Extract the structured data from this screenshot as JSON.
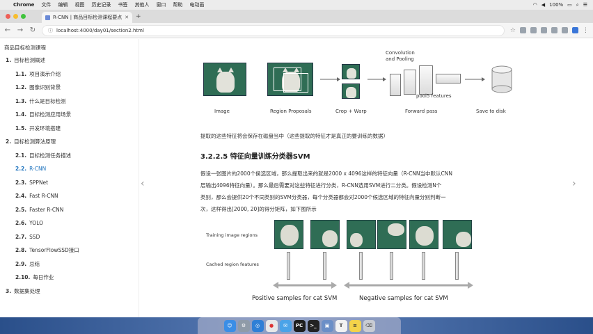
{
  "menubar": {
    "app": "Chrome",
    "items": [
      "文件",
      "编辑",
      "视图",
      "历史记录",
      "书签",
      "其他人",
      "窗口",
      "帮助",
      "电动画"
    ],
    "status": "100%",
    "time": ""
  },
  "tab": {
    "title": "R-CNN | 商品目标检测课程要点"
  },
  "url": "localhost:4000/day01/section2.html",
  "sidebar": {
    "title": "商品目标检测课程",
    "items": [
      {
        "num": "1.",
        "label": "目标检测概述",
        "level": 1
      },
      {
        "num": "1.1.",
        "label": "项目演示介绍",
        "level": 2
      },
      {
        "num": "1.2.",
        "label": "图像识别背景",
        "level": 2
      },
      {
        "num": "1.3.",
        "label": "什么是目标检测",
        "level": 2
      },
      {
        "num": "1.4.",
        "label": "目标检测应用场景",
        "level": 2
      },
      {
        "num": "1.5.",
        "label": "开发环境搭建",
        "level": 2
      },
      {
        "num": "2.",
        "label": "目标检测算法原理",
        "level": 1
      },
      {
        "num": "2.1.",
        "label": "目标检测任务描述",
        "level": 2
      },
      {
        "num": "2.2.",
        "label": "R-CNN",
        "level": 2,
        "active": true
      },
      {
        "num": "2.3.",
        "label": "SPPNet",
        "level": 2
      },
      {
        "num": "2.4.",
        "label": "Fast R-CNN",
        "level": 2
      },
      {
        "num": "2.5.",
        "label": "Faster R-CNN",
        "level": 2
      },
      {
        "num": "2.6.",
        "label": "YOLO",
        "level": 2
      },
      {
        "num": "2.7.",
        "label": "SSD",
        "level": 2
      },
      {
        "num": "2.8.",
        "label": "TensorFlowSSD接口",
        "level": 2
      },
      {
        "num": "2.9.",
        "label": "总结",
        "level": 2
      },
      {
        "num": "2.10.",
        "label": "每日作业",
        "level": 2
      },
      {
        "num": "3.",
        "label": "数据集处理",
        "level": 1
      }
    ]
  },
  "pipeline": {
    "labels": [
      "Image",
      "Region Proposals",
      "Crop + Warp",
      "Convolution",
      "and Pooling",
      "pool5 features",
      "Forward pass",
      "Save to disk"
    ]
  },
  "content": {
    "caption_line": "提取的这些特征将会保存在磁盘当中（这些提取的特征才是真正的要训练的数据）",
    "heading": "3.2.2.5 特征向量训练分类器SVM",
    "para_lines": [
      "假设一张图片的2000个侯选区域，那么提取出来的就是2000 x 4096这样的特征向量（R-CNN当中默认CNN",
      "层输出4096特征向量）。那么最后需要对这些特征进行分类，R-CNN选用SVM进行二分类。假设检测N个",
      "类别，那么会提供20个不同类别的SVM分类器，每个分类器都会对2000个候选区域的特征向量分别判断一",
      "次，这样得出[2000, 20]的得分矩阵，如下图所示"
    ]
  },
  "svm": {
    "row1_label": "Training image regions",
    "row2_label": "Cached region features",
    "positive": "Positive samples for cat SVM",
    "negative": "Negative samples for cat SVM"
  },
  "dock": {
    "icons": [
      "finder-icon",
      "launchpad-icon",
      "safari-icon",
      "chrome-icon",
      "mail-icon",
      "pycharm-icon",
      "terminal-icon",
      "preview-icon",
      "typora-icon",
      "notes-icon",
      "trash-icon"
    ]
  }
}
